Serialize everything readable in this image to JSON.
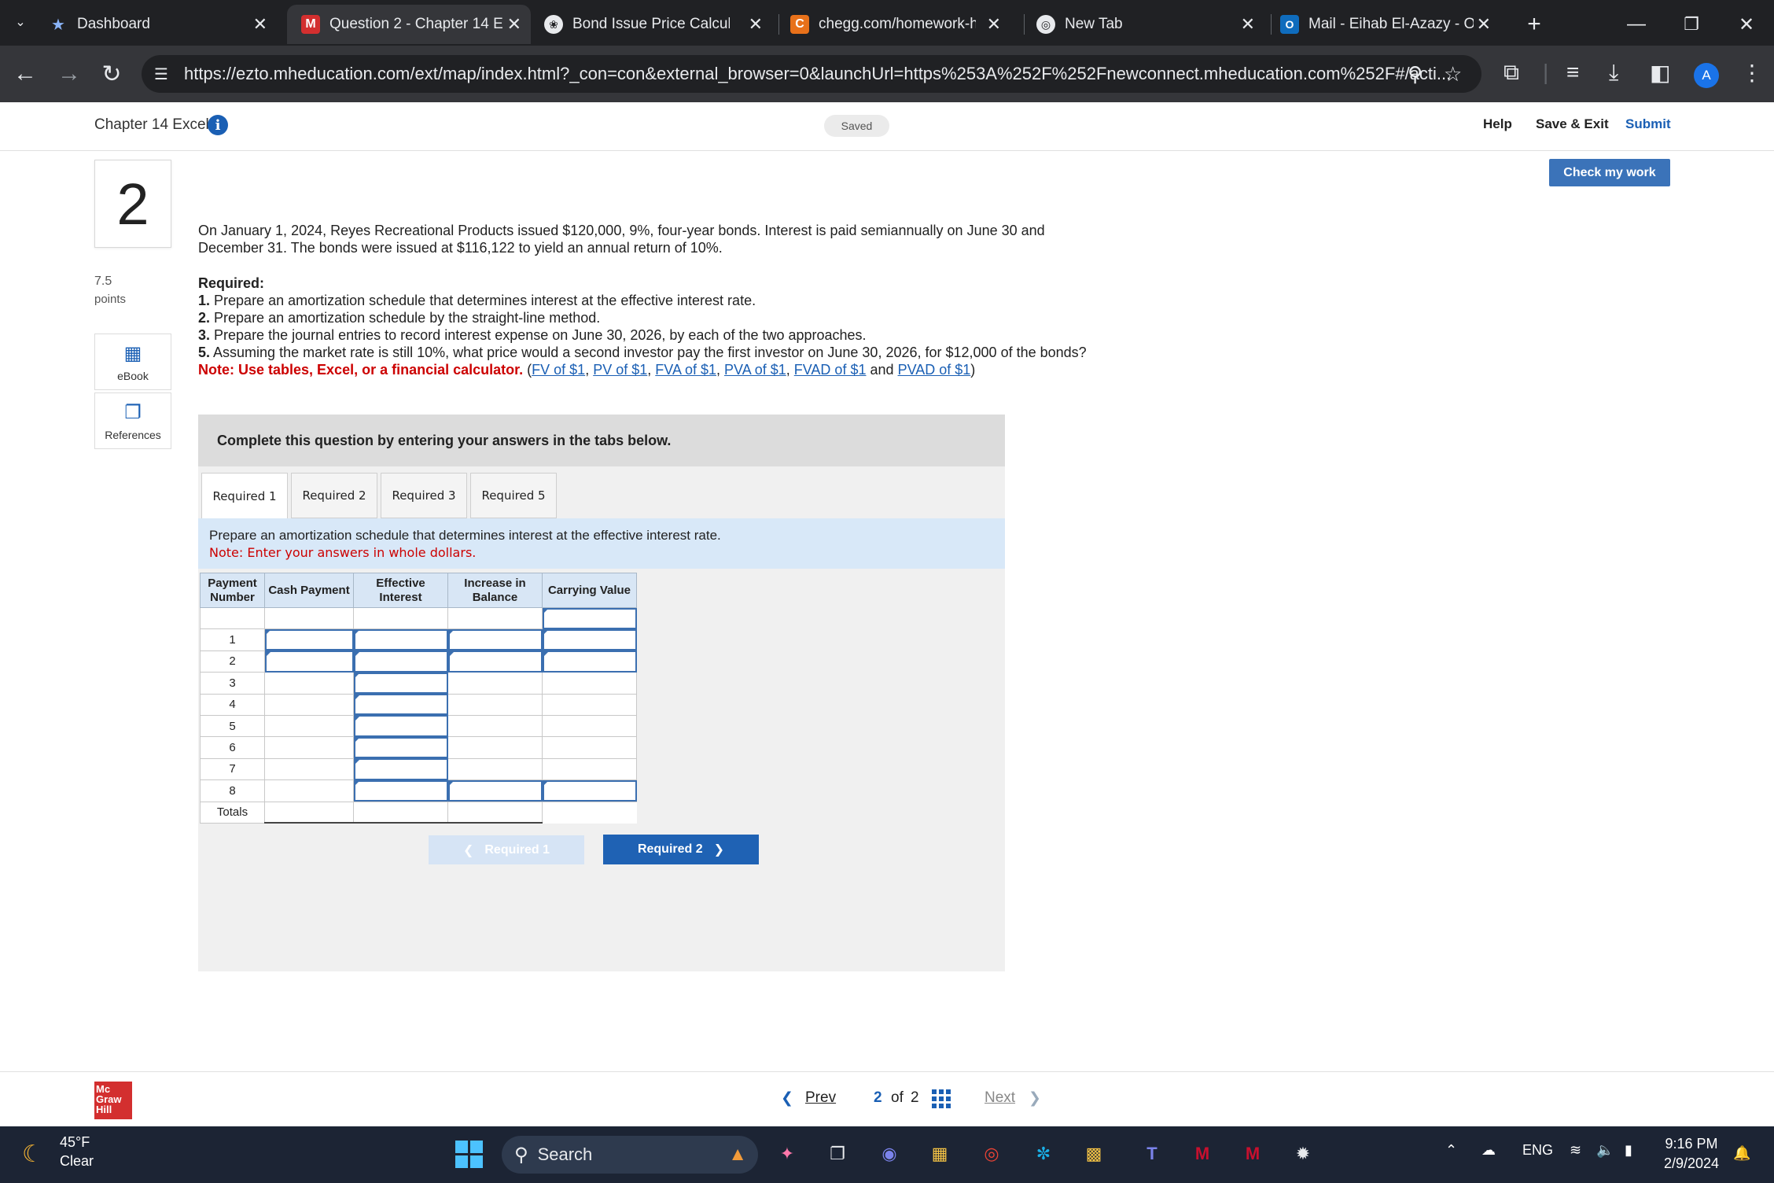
{
  "browser": {
    "tabs": [
      {
        "label": "Dashboard",
        "icon": "star-icon"
      },
      {
        "label": "Question 2 - Chapter 14 E",
        "icon": "mheducation-logo-icon"
      },
      {
        "label": "Bond Issue Price Calculati",
        "icon": "chatgpt-icon"
      },
      {
        "label": "chegg.com/homework-he",
        "icon": "chegg-icon"
      },
      {
        "label": "New Tab",
        "icon": "chrome-icon"
      },
      {
        "label": "Mail - Eihab El-Azazy - Ou",
        "icon": "outlook-icon"
      }
    ],
    "url": "https://ezto.mheducation.com/ext/map/index.html?_con=con&external_browser=0&launchUrl=https%253A%252F%252Fnewconnect.mheducation.com%252F#/acti...",
    "profile_initial": "A"
  },
  "header": {
    "chapter_title": "Chapter 14 Excel",
    "saved": "Saved",
    "help": "Help",
    "save_exit": "Save & Exit",
    "submit": "Submit",
    "check_my_work": "Check my work"
  },
  "rail": {
    "question_number": "2",
    "points_value": "7.5",
    "points_label": "points",
    "ebook": "eBook",
    "references": "References"
  },
  "question": {
    "intro": "On January 1, 2024, Reyes Recreational Products issued $120,000, 9%, four-year bonds. Interest is paid semiannually on June 30 and December 31. The bonds were issued at $116,122 to yield an annual return of 10%.",
    "required_heading": "Required:",
    "items": [
      {
        "num": "1.",
        "text": "Prepare an amortization schedule that determines interest at the effective interest rate."
      },
      {
        "num": "2.",
        "text": "Prepare an amortization schedule by the straight-line method."
      },
      {
        "num": "3.",
        "text": "Prepare the journal entries to record interest expense on June 30, 2026, by each of the two approaches."
      },
      {
        "num": "5.",
        "text": "Assuming the market rate is still 10%, what price would a second investor pay the first investor on June 30, 2026, for $12,000 of the bonds?"
      }
    ],
    "note_label": "Note: Use tables, Excel, or a financial calculator.",
    "note_links": [
      "FV of $1",
      "PV of $1",
      "FVA of $1",
      "PVA of $1",
      "FVAD of $1",
      "PVAD of $1"
    ],
    "note_and": "and"
  },
  "work": {
    "header": "Complete this question by entering your answers in the tabs below.",
    "tabs": [
      "Required 1",
      "Required 2",
      "Required 3",
      "Required 5"
    ],
    "active_tab": 0,
    "prompt": "Prepare an amortization schedule that determines interest at the effective interest rate.",
    "prompt_note": "Note: Enter your answers in whole dollars.",
    "table": {
      "headers": [
        "Payment Number",
        "Cash Payment",
        "Effective Interest",
        "Increase in Balance",
        "Carrying Value"
      ],
      "rows": [
        "",
        "1",
        "2",
        "3",
        "4",
        "5",
        "6",
        "7",
        "8",
        "Totals"
      ]
    },
    "prev_button": "Required 1",
    "next_button": "Required 2"
  },
  "footer": {
    "logo_text": [
      "Mc",
      "Graw",
      "Hill"
    ],
    "prev": "Prev",
    "page_current": "2",
    "page_of": "of",
    "page_total": "2",
    "next": "Next"
  },
  "taskbar": {
    "temperature": "45°F",
    "condition": "Clear",
    "search_placeholder": "Search",
    "language": "ENG",
    "time": "9:16 PM",
    "date": "2/9/2024"
  }
}
